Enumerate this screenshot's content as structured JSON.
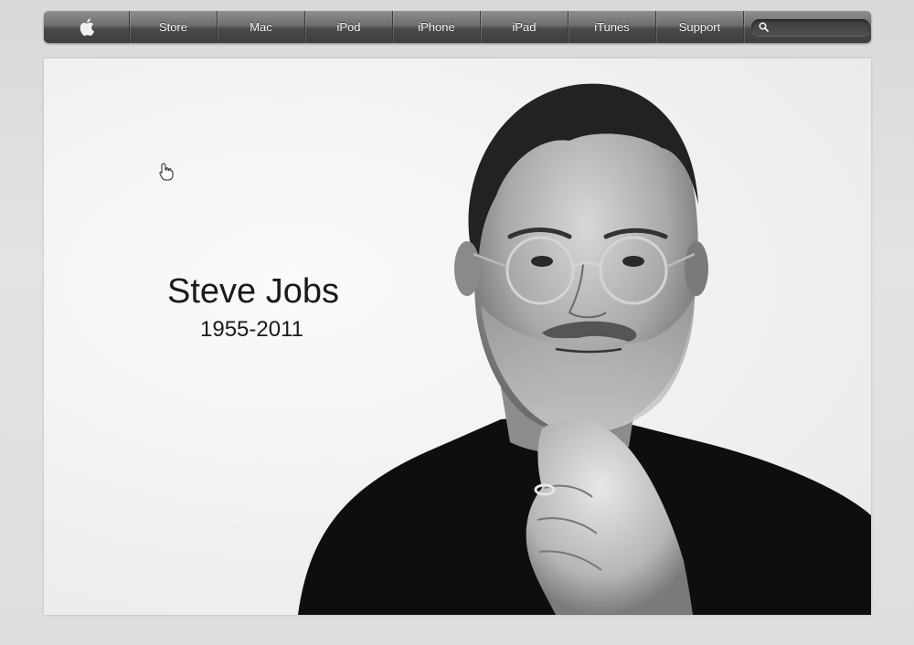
{
  "nav": {
    "items": [
      {
        "label": "Store"
      },
      {
        "label": "Mac"
      },
      {
        "label": "iPod"
      },
      {
        "label": "iPhone"
      },
      {
        "label": "iPad"
      },
      {
        "label": "iTunes"
      },
      {
        "label": "Support"
      }
    ],
    "apple_icon": "apple-logo-icon",
    "search_icon": "search-icon",
    "search_value": ""
  },
  "hero": {
    "name": "Steve Jobs",
    "dates": "1955-2011",
    "cursor_icon": "hand-pointer-icon",
    "portrait": "black-and-white-portrait"
  }
}
